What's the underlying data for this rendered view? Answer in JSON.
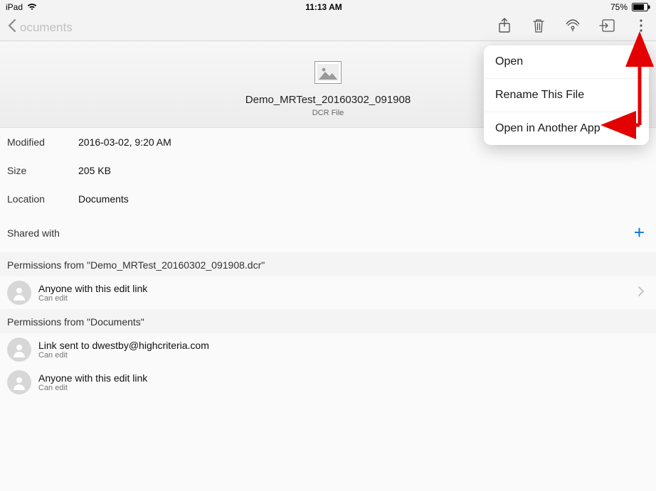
{
  "status": {
    "device": "iPad",
    "time": "11:13 AM",
    "battery": "75%"
  },
  "nav": {
    "back_label": "ocuments"
  },
  "file": {
    "name": "Demo_MRTest_20160302_091908",
    "type_label": "DCR File"
  },
  "info": {
    "modified_label": "Modified",
    "modified_value": "2016-03-02, 9:20 AM",
    "size_label": "Size",
    "size_value": "205 KB",
    "location_label": "Location",
    "location_value": "Documents"
  },
  "shared": {
    "label": "Shared with"
  },
  "perm_group_1": {
    "heading": "Permissions from \"Demo_MRTest_20160302_091908.dcr\"",
    "items": [
      {
        "title": "Anyone with this edit link",
        "sub": "Can edit"
      }
    ]
  },
  "perm_group_2": {
    "heading": "Permissions from \"Documents\"",
    "items": [
      {
        "title": "Link sent to dwestby@highcriteria.com",
        "sub": "Can edit"
      },
      {
        "title": "Anyone with this edit link",
        "sub": "Can edit"
      }
    ]
  },
  "menu": {
    "open": "Open",
    "rename": "Rename This File",
    "open_another": "Open in Another App"
  }
}
